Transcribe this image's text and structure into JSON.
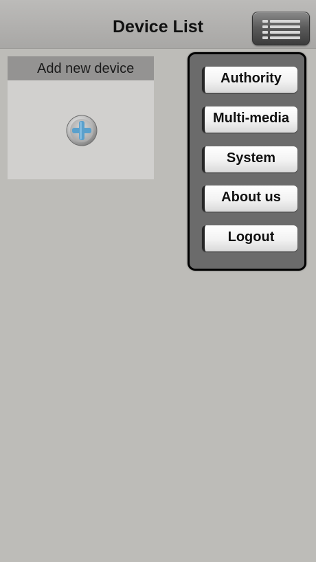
{
  "header": {
    "title": "Device List",
    "menu_icon": "list-menu-icon"
  },
  "add_device": {
    "label": "Add new device",
    "icon": "plus-circle-icon"
  },
  "menu": {
    "items": [
      {
        "label": "Authority"
      },
      {
        "label": "Multi-media"
      },
      {
        "label": "System"
      },
      {
        "label": "About us"
      },
      {
        "label": "Logout"
      }
    ]
  },
  "colors": {
    "background": "#bdbcb8",
    "header": "#b3b2b0",
    "card_header": "#949392",
    "card_body": "#d1d0ce",
    "dropdown_bg": "#6b6b6b",
    "plus_accent": "#5aa0cc"
  }
}
